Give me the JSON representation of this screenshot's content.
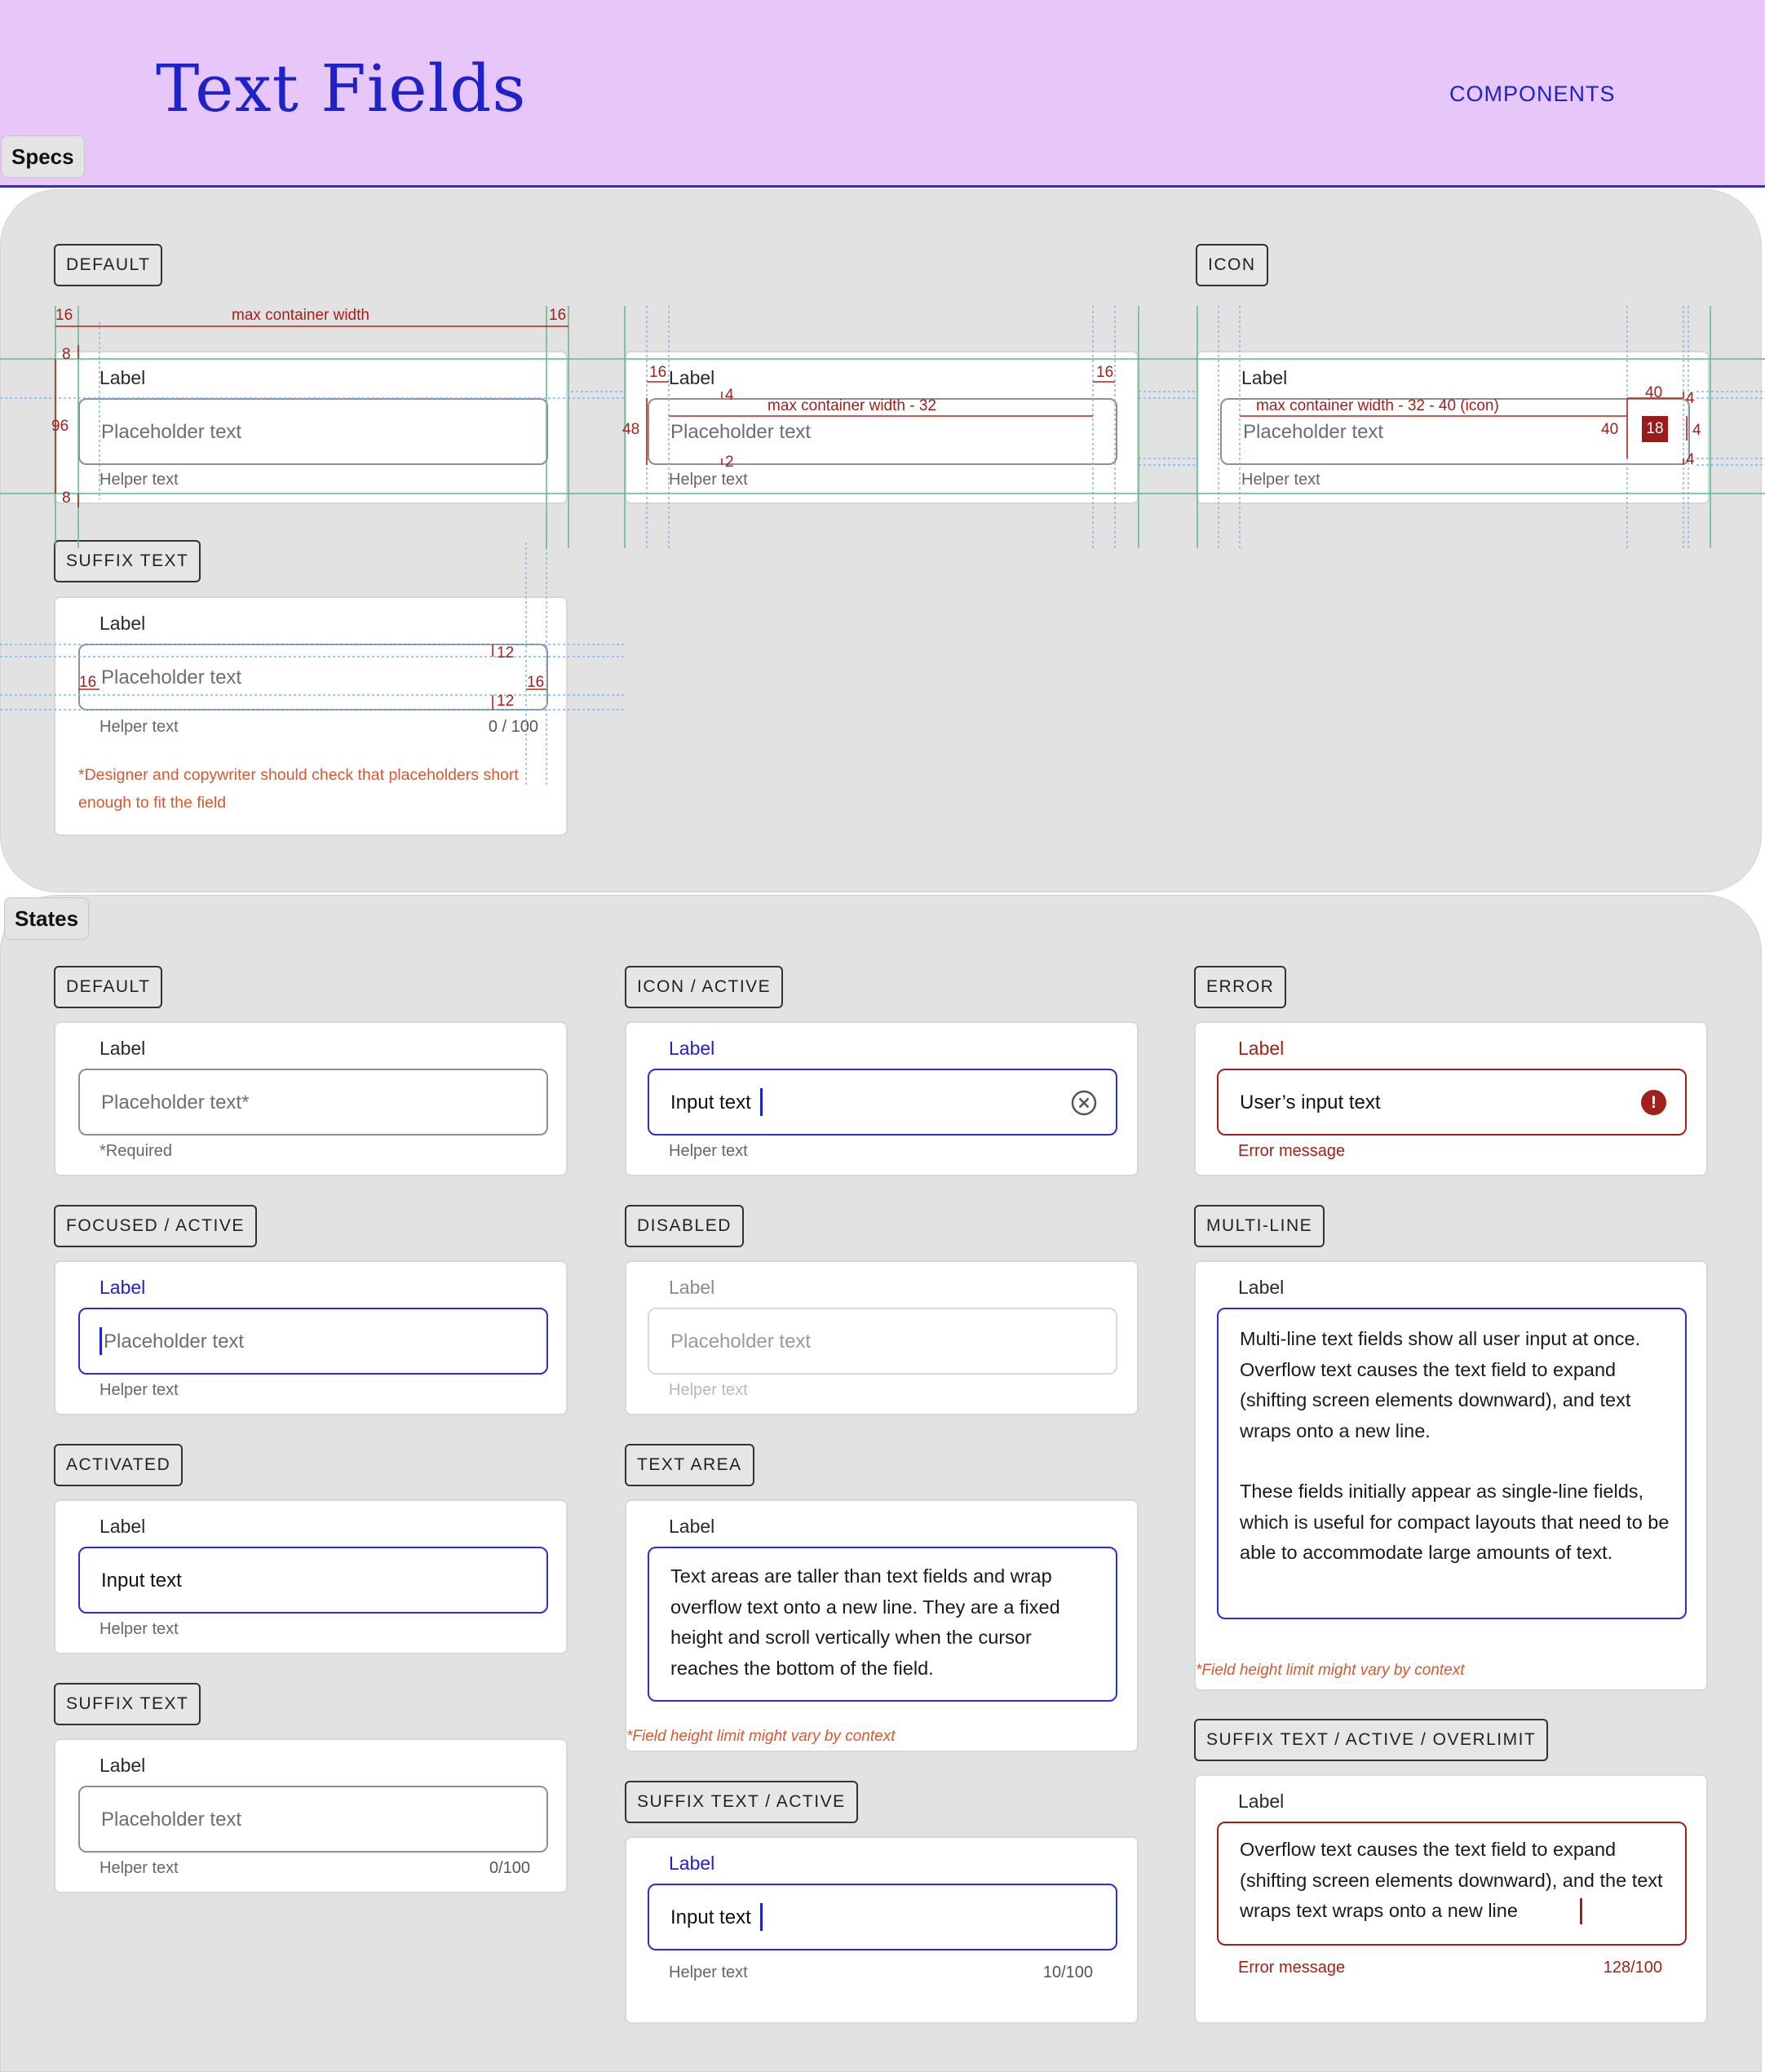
{
  "header": {
    "title": "Text Fields",
    "link": "COMPONENTS"
  },
  "sections": {
    "specs": "Specs",
    "states": "States"
  },
  "common": {
    "label": "Label",
    "placeholder": "Placeholder text",
    "helper": "Helper text"
  },
  "specs": {
    "default_tag": "DEFAULT",
    "icon_tag": "ICON",
    "suffix_tag": "SUFFIX TEXT",
    "annotations": {
      "max_width": "max container width",
      "max_width_32": "max container width - 32",
      "max_width_icon": "max container width - 32 - 40 (icon)",
      "n16": "16",
      "n8": "8",
      "n96": "96",
      "n48": "48",
      "n4": "4",
      "n2": "2",
      "n40": "40",
      "n18": "18",
      "n12": "12"
    },
    "suffix_counter": "0 / 100",
    "suffix_note": "*Designer and copywriter should check that  placeholders short enough to fit the field"
  },
  "states": {
    "default": {
      "tag": "DEFAULT",
      "placeholder": "Placeholder text*",
      "helper": "*Required"
    },
    "icon_active": {
      "tag": "ICON / ACTIVE",
      "value": "Input text",
      "icon": "clear-circle-icon"
    },
    "error": {
      "tag": "ERROR",
      "value": "User’s input text",
      "helper": "Error message",
      "icon": "error-icon",
      "icon_glyph": "!"
    },
    "focused": {
      "tag": "FOCUSED / ACTIVE"
    },
    "disabled": {
      "tag": "DISABLED"
    },
    "multiline": {
      "tag": "MULTI-LINE",
      "para1": "Multi-line text fields show all user input at once. Overflow text causes the text field to expand (shifting screen elements downward), and text wraps onto a new line.",
      "para2": "These fields initially appear as single-line fields, which is useful for compact layouts that need to be able to accommodate large amounts of text.",
      "note": "*Field height limit might vary by context"
    },
    "activated": {
      "tag": "ACTIVATED",
      "value": "Input text"
    },
    "textarea": {
      "tag": "TEXT AREA",
      "text": "Text areas are taller than text fields and wrap overflow text onto a new line. They are a fixed height and scroll vertically when the cursor reaches the bottom of the field.",
      "note": "*Field height limit might vary by context"
    },
    "suffix": {
      "tag": "SUFFIX TEXT",
      "counter": "0/100"
    },
    "suffix_active": {
      "tag": "SUFFIX TEXT / ACTIVE",
      "value": "Input text",
      "counter": "10/100"
    },
    "suffix_overlimit": {
      "tag": "SUFFIX TEXT / ACTIVE / OVERLIMIT",
      "text": "Overflow text causes the text field to expand (shifting screen elements downward), and the text wraps text wraps onto a new line",
      "helper": "Error message",
      "counter": "128/100"
    }
  },
  "colors": {
    "header_bg": "#e7c7fa",
    "accent_blue": "#1e22c8",
    "error_red": "#a0211b",
    "spec_red": "#b3261e",
    "guide_green": "#2f9b5c",
    "note_orange": "#d25a32"
  }
}
